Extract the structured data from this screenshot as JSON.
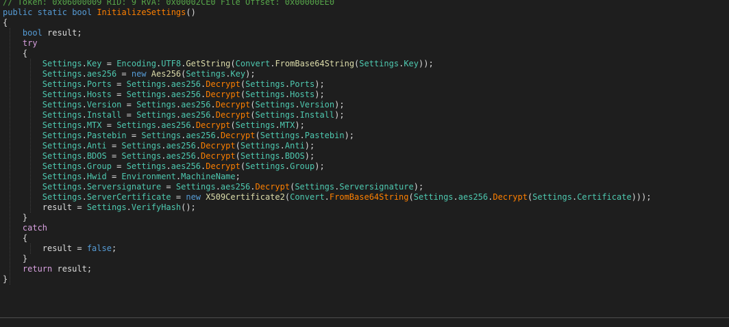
{
  "colors": {
    "background": "#1e1e1e",
    "text": "#dcdcdc",
    "keyword": "#569cd6",
    "control": "#d8a0df",
    "type": "#4ec9b0",
    "member": "#4ec9b0",
    "method": "#ff8000",
    "constructor": "#dcdcaa",
    "comment": "#57a64a",
    "guide": "#404040"
  },
  "editor": {
    "lines": [
      [
        {
          "t": "// Token: 0x06000009 RID: 9 RVA: 0x00002CE0 File Offset: 0x00000EE0",
          "c": "comment"
        }
      ],
      [
        {
          "t": "public",
          "c": "keyword"
        },
        {
          "t": " ",
          "c": "text"
        },
        {
          "t": "static",
          "c": "keyword"
        },
        {
          "t": " ",
          "c": "text"
        },
        {
          "t": "bool",
          "c": "keyword"
        },
        {
          "t": " ",
          "c": "text"
        },
        {
          "t": "InitializeSettings",
          "c": "method"
        },
        {
          "t": "()",
          "c": "text"
        }
      ],
      [
        {
          "t": "{",
          "c": "text"
        }
      ],
      [
        {
          "t": "    ",
          "c": "text"
        },
        {
          "t": "bool",
          "c": "keyword"
        },
        {
          "t": " result;",
          "c": "text"
        }
      ],
      [
        {
          "t": "    ",
          "c": "text"
        },
        {
          "t": "try",
          "c": "control"
        }
      ],
      [
        {
          "t": "    {",
          "c": "text"
        }
      ],
      [
        {
          "t": "        ",
          "c": "text"
        },
        {
          "t": "Settings",
          "c": "type"
        },
        {
          "t": ".",
          "c": "text"
        },
        {
          "t": "Key",
          "c": "member"
        },
        {
          "t": " = ",
          "c": "text"
        },
        {
          "t": "Encoding",
          "c": "type"
        },
        {
          "t": ".",
          "c": "text"
        },
        {
          "t": "UTF8",
          "c": "member"
        },
        {
          "t": ".",
          "c": "text"
        },
        {
          "t": "GetString",
          "c": "constructor"
        },
        {
          "t": "(",
          "c": "text"
        },
        {
          "t": "Convert",
          "c": "type"
        },
        {
          "t": ".",
          "c": "text"
        },
        {
          "t": "FromBase64String",
          "c": "constructor"
        },
        {
          "t": "(",
          "c": "text"
        },
        {
          "t": "Settings",
          "c": "type"
        },
        {
          "t": ".",
          "c": "text"
        },
        {
          "t": "Key",
          "c": "member"
        },
        {
          "t": "));",
          "c": "text"
        }
      ],
      [
        {
          "t": "        ",
          "c": "text"
        },
        {
          "t": "Settings",
          "c": "type"
        },
        {
          "t": ".",
          "c": "text"
        },
        {
          "t": "aes256",
          "c": "member"
        },
        {
          "t": " = ",
          "c": "text"
        },
        {
          "t": "new",
          "c": "keyword"
        },
        {
          "t": " ",
          "c": "text"
        },
        {
          "t": "Aes256",
          "c": "constructor"
        },
        {
          "t": "(",
          "c": "text"
        },
        {
          "t": "Settings",
          "c": "type"
        },
        {
          "t": ".",
          "c": "text"
        },
        {
          "t": "Key",
          "c": "member"
        },
        {
          "t": ");",
          "c": "text"
        }
      ],
      [
        {
          "t": "        ",
          "c": "text"
        },
        {
          "t": "Settings",
          "c": "type"
        },
        {
          "t": ".",
          "c": "text"
        },
        {
          "t": "Ports",
          "c": "member"
        },
        {
          "t": " = ",
          "c": "text"
        },
        {
          "t": "Settings",
          "c": "type"
        },
        {
          "t": ".",
          "c": "text"
        },
        {
          "t": "aes256",
          "c": "member"
        },
        {
          "t": ".",
          "c": "text"
        },
        {
          "t": "Decrypt",
          "c": "method"
        },
        {
          "t": "(",
          "c": "text"
        },
        {
          "t": "Settings",
          "c": "type"
        },
        {
          "t": ".",
          "c": "text"
        },
        {
          "t": "Ports",
          "c": "member"
        },
        {
          "t": ");",
          "c": "text"
        }
      ],
      [
        {
          "t": "        ",
          "c": "text"
        },
        {
          "t": "Settings",
          "c": "type"
        },
        {
          "t": ".",
          "c": "text"
        },
        {
          "t": "Hosts",
          "c": "member"
        },
        {
          "t": " = ",
          "c": "text"
        },
        {
          "t": "Settings",
          "c": "type"
        },
        {
          "t": ".",
          "c": "text"
        },
        {
          "t": "aes256",
          "c": "member"
        },
        {
          "t": ".",
          "c": "text"
        },
        {
          "t": "Decrypt",
          "c": "method"
        },
        {
          "t": "(",
          "c": "text"
        },
        {
          "t": "Settings",
          "c": "type"
        },
        {
          "t": ".",
          "c": "text"
        },
        {
          "t": "Hosts",
          "c": "member"
        },
        {
          "t": ");",
          "c": "text"
        }
      ],
      [
        {
          "t": "        ",
          "c": "text"
        },
        {
          "t": "Settings",
          "c": "type"
        },
        {
          "t": ".",
          "c": "text"
        },
        {
          "t": "Version",
          "c": "member"
        },
        {
          "t": " = ",
          "c": "text"
        },
        {
          "t": "Settings",
          "c": "type"
        },
        {
          "t": ".",
          "c": "text"
        },
        {
          "t": "aes256",
          "c": "member"
        },
        {
          "t": ".",
          "c": "text"
        },
        {
          "t": "Decrypt",
          "c": "method"
        },
        {
          "t": "(",
          "c": "text"
        },
        {
          "t": "Settings",
          "c": "type"
        },
        {
          "t": ".",
          "c": "text"
        },
        {
          "t": "Version",
          "c": "member"
        },
        {
          "t": ");",
          "c": "text"
        }
      ],
      [
        {
          "t": "        ",
          "c": "text"
        },
        {
          "t": "Settings",
          "c": "type"
        },
        {
          "t": ".",
          "c": "text"
        },
        {
          "t": "Install",
          "c": "member"
        },
        {
          "t": " = ",
          "c": "text"
        },
        {
          "t": "Settings",
          "c": "type"
        },
        {
          "t": ".",
          "c": "text"
        },
        {
          "t": "aes256",
          "c": "member"
        },
        {
          "t": ".",
          "c": "text"
        },
        {
          "t": "Decrypt",
          "c": "method"
        },
        {
          "t": "(",
          "c": "text"
        },
        {
          "t": "Settings",
          "c": "type"
        },
        {
          "t": ".",
          "c": "text"
        },
        {
          "t": "Install",
          "c": "member"
        },
        {
          "t": ");",
          "c": "text"
        }
      ],
      [
        {
          "t": "        ",
          "c": "text"
        },
        {
          "t": "Settings",
          "c": "type"
        },
        {
          "t": ".",
          "c": "text"
        },
        {
          "t": "MTX",
          "c": "member"
        },
        {
          "t": " = ",
          "c": "text"
        },
        {
          "t": "Settings",
          "c": "type"
        },
        {
          "t": ".",
          "c": "text"
        },
        {
          "t": "aes256",
          "c": "member"
        },
        {
          "t": ".",
          "c": "text"
        },
        {
          "t": "Decrypt",
          "c": "method"
        },
        {
          "t": "(",
          "c": "text"
        },
        {
          "t": "Settings",
          "c": "type"
        },
        {
          "t": ".",
          "c": "text"
        },
        {
          "t": "MTX",
          "c": "member"
        },
        {
          "t": ");",
          "c": "text"
        }
      ],
      [
        {
          "t": "        ",
          "c": "text"
        },
        {
          "t": "Settings",
          "c": "type"
        },
        {
          "t": ".",
          "c": "text"
        },
        {
          "t": "Pastebin",
          "c": "member"
        },
        {
          "t": " = ",
          "c": "text"
        },
        {
          "t": "Settings",
          "c": "type"
        },
        {
          "t": ".",
          "c": "text"
        },
        {
          "t": "aes256",
          "c": "member"
        },
        {
          "t": ".",
          "c": "text"
        },
        {
          "t": "Decrypt",
          "c": "method"
        },
        {
          "t": "(",
          "c": "text"
        },
        {
          "t": "Settings",
          "c": "type"
        },
        {
          "t": ".",
          "c": "text"
        },
        {
          "t": "Pastebin",
          "c": "member"
        },
        {
          "t": ");",
          "c": "text"
        }
      ],
      [
        {
          "t": "        ",
          "c": "text"
        },
        {
          "t": "Settings",
          "c": "type"
        },
        {
          "t": ".",
          "c": "text"
        },
        {
          "t": "Anti",
          "c": "member"
        },
        {
          "t": " = ",
          "c": "text"
        },
        {
          "t": "Settings",
          "c": "type"
        },
        {
          "t": ".",
          "c": "text"
        },
        {
          "t": "aes256",
          "c": "member"
        },
        {
          "t": ".",
          "c": "text"
        },
        {
          "t": "Decrypt",
          "c": "method"
        },
        {
          "t": "(",
          "c": "text"
        },
        {
          "t": "Settings",
          "c": "type"
        },
        {
          "t": ".",
          "c": "text"
        },
        {
          "t": "Anti",
          "c": "member"
        },
        {
          "t": ");",
          "c": "text"
        }
      ],
      [
        {
          "t": "        ",
          "c": "text"
        },
        {
          "t": "Settings",
          "c": "type"
        },
        {
          "t": ".",
          "c": "text"
        },
        {
          "t": "BDOS",
          "c": "member"
        },
        {
          "t": " = ",
          "c": "text"
        },
        {
          "t": "Settings",
          "c": "type"
        },
        {
          "t": ".",
          "c": "text"
        },
        {
          "t": "aes256",
          "c": "member"
        },
        {
          "t": ".",
          "c": "text"
        },
        {
          "t": "Decrypt",
          "c": "method"
        },
        {
          "t": "(",
          "c": "text"
        },
        {
          "t": "Settings",
          "c": "type"
        },
        {
          "t": ".",
          "c": "text"
        },
        {
          "t": "BDOS",
          "c": "member"
        },
        {
          "t": ");",
          "c": "text"
        }
      ],
      [
        {
          "t": "        ",
          "c": "text"
        },
        {
          "t": "Settings",
          "c": "type"
        },
        {
          "t": ".",
          "c": "text"
        },
        {
          "t": "Group",
          "c": "member"
        },
        {
          "t": " = ",
          "c": "text"
        },
        {
          "t": "Settings",
          "c": "type"
        },
        {
          "t": ".",
          "c": "text"
        },
        {
          "t": "aes256",
          "c": "member"
        },
        {
          "t": ".",
          "c": "text"
        },
        {
          "t": "Decrypt",
          "c": "method"
        },
        {
          "t": "(",
          "c": "text"
        },
        {
          "t": "Settings",
          "c": "type"
        },
        {
          "t": ".",
          "c": "text"
        },
        {
          "t": "Group",
          "c": "member"
        },
        {
          "t": ");",
          "c": "text"
        }
      ],
      [
        {
          "t": "        ",
          "c": "text"
        },
        {
          "t": "Settings",
          "c": "type"
        },
        {
          "t": ".",
          "c": "text"
        },
        {
          "t": "Hwid",
          "c": "member"
        },
        {
          "t": " = ",
          "c": "text"
        },
        {
          "t": "Environment",
          "c": "type"
        },
        {
          "t": ".",
          "c": "text"
        },
        {
          "t": "MachineName",
          "c": "member"
        },
        {
          "t": ";",
          "c": "text"
        }
      ],
      [
        {
          "t": "        ",
          "c": "text"
        },
        {
          "t": "Settings",
          "c": "type"
        },
        {
          "t": ".",
          "c": "text"
        },
        {
          "t": "Serversignature",
          "c": "member"
        },
        {
          "t": " = ",
          "c": "text"
        },
        {
          "t": "Settings",
          "c": "type"
        },
        {
          "t": ".",
          "c": "text"
        },
        {
          "t": "aes256",
          "c": "member"
        },
        {
          "t": ".",
          "c": "text"
        },
        {
          "t": "Decrypt",
          "c": "method"
        },
        {
          "t": "(",
          "c": "text"
        },
        {
          "t": "Settings",
          "c": "type"
        },
        {
          "t": ".",
          "c": "text"
        },
        {
          "t": "Serversignature",
          "c": "member"
        },
        {
          "t": ");",
          "c": "text"
        }
      ],
      [
        {
          "t": "        ",
          "c": "text"
        },
        {
          "t": "Settings",
          "c": "type"
        },
        {
          "t": ".",
          "c": "text"
        },
        {
          "t": "ServerCertificate",
          "c": "member"
        },
        {
          "t": " = ",
          "c": "text"
        },
        {
          "t": "new",
          "c": "keyword"
        },
        {
          "t": " ",
          "c": "text"
        },
        {
          "t": "X509Certificate2",
          "c": "constructor"
        },
        {
          "t": "(",
          "c": "text"
        },
        {
          "t": "Convert",
          "c": "type"
        },
        {
          "t": ".",
          "c": "text"
        },
        {
          "t": "FromBase64String",
          "c": "method"
        },
        {
          "t": "(",
          "c": "text"
        },
        {
          "t": "Settings",
          "c": "type"
        },
        {
          "t": ".",
          "c": "text"
        },
        {
          "t": "aes256",
          "c": "member"
        },
        {
          "t": ".",
          "c": "text"
        },
        {
          "t": "Decrypt",
          "c": "method"
        },
        {
          "t": "(",
          "c": "text"
        },
        {
          "t": "Settings",
          "c": "type"
        },
        {
          "t": ".",
          "c": "text"
        },
        {
          "t": "Certificate",
          "c": "member"
        },
        {
          "t": ")));",
          "c": "text"
        }
      ],
      [
        {
          "t": "        result = ",
          "c": "text"
        },
        {
          "t": "Settings",
          "c": "type"
        },
        {
          "t": ".",
          "c": "text"
        },
        {
          "t": "VerifyHash",
          "c": "member"
        },
        {
          "t": "();",
          "c": "text"
        }
      ],
      [
        {
          "t": "    }",
          "c": "text"
        }
      ],
      [
        {
          "t": "    ",
          "c": "text"
        },
        {
          "t": "catch",
          "c": "control"
        }
      ],
      [
        {
          "t": "    {",
          "c": "text"
        }
      ],
      [
        {
          "t": "        result = ",
          "c": "text"
        },
        {
          "t": "false",
          "c": "keyword"
        },
        {
          "t": ";",
          "c": "text"
        }
      ],
      [
        {
          "t": "    }",
          "c": "text"
        }
      ],
      [
        {
          "t": "    ",
          "c": "text"
        },
        {
          "t": "return",
          "c": "control"
        },
        {
          "t": " result;",
          "c": "text"
        }
      ],
      [
        {
          "t": "}",
          "c": "text"
        }
      ]
    ]
  }
}
